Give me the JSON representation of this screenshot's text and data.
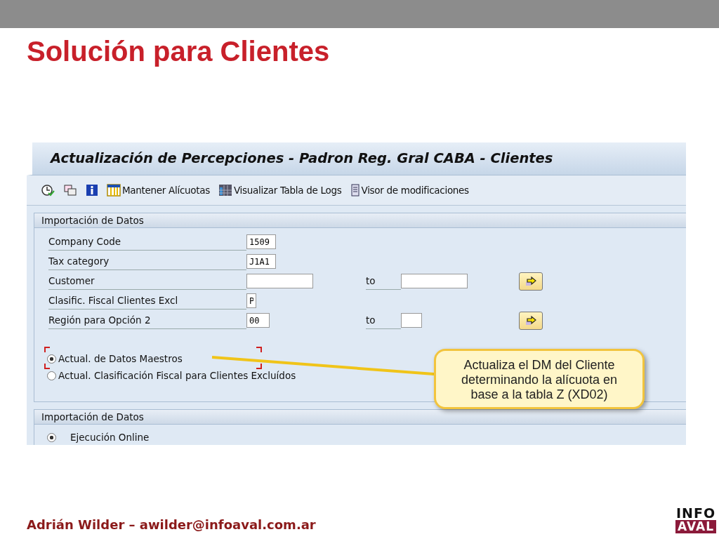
{
  "slide": {
    "title": "Solución para Clientes",
    "footer": "Adrián Wilder – awilder@infoaval.com.ar",
    "logo": {
      "top": "INFO",
      "bottom": "AVAL"
    }
  },
  "window": {
    "title": "Actualización de Percepciones - Padron Reg. Gral CABA - Clientes"
  },
  "toolbar": [
    {
      "kind": "clock"
    },
    {
      "kind": "copy"
    },
    {
      "kind": "info"
    },
    {
      "kind": "table",
      "label": "Mantener Alícuotas"
    },
    {
      "kind": "grid",
      "label": "Visualizar Tabla de Logs"
    },
    {
      "kind": "doc",
      "label": "Visor de modificaciones"
    }
  ],
  "section_1": {
    "title": "Importación de Datos",
    "fields": [
      {
        "label": "Company Code",
        "value": "1509",
        "kind": "single"
      },
      {
        "label": "Tax category",
        "value": "J1A1",
        "kind": "single"
      },
      {
        "label": "Customer",
        "kind": "range",
        "to_label": "to"
      },
      {
        "label": "Clasific. Fiscal Clientes Excl",
        "value": "P",
        "kind": "single"
      },
      {
        "label": "Región para Opción 2",
        "value": "00",
        "kind": "range",
        "to_label": "to"
      }
    ],
    "options": [
      {
        "label": "Actual. de Datos Maestros",
        "selected": true
      },
      {
        "label": "Actual. Clasificación Fiscal para Clientes Excluídos",
        "selected": false
      }
    ]
  },
  "callout": {
    "text": "Actualiza el DM del Cliente determinando la alícuota en base a la tabla Z (XD02)"
  },
  "section_2": {
    "title": "Importación de Datos",
    "options": [
      {
        "label": "Ejecución Online",
        "selected": true
      }
    ]
  }
}
